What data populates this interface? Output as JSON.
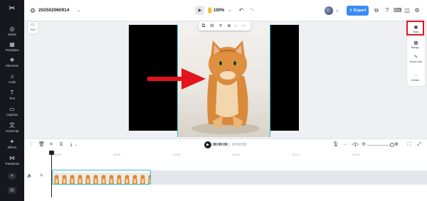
{
  "sidebar": {
    "items": [
      {
        "label": "Media",
        "icon": "media-icon"
      },
      {
        "label": "Templates",
        "icon": "templates-icon"
      },
      {
        "label": "Elements",
        "icon": "elements-icon"
      },
      {
        "label": "Audio",
        "icon": "audio-icon"
      },
      {
        "label": "Text",
        "icon": "text-icon"
      },
      {
        "label": "Captions",
        "icon": "captions-icon"
      },
      {
        "label": "Transcript",
        "icon": "transcript-icon"
      },
      {
        "label": "Effects",
        "icon": "effects-icon"
      },
      {
        "label": "Transitions",
        "icon": "transitions-icon"
      }
    ]
  },
  "topbar": {
    "project_name": "202502060914",
    "zoom": "100%",
    "export_label": "Export"
  },
  "canvas": {
    "ratio_label": "16:9"
  },
  "right_panel": {
    "items": [
      {
        "label": "Basic",
        "icon": "basic-icon"
      },
      {
        "label": "Backgr...",
        "icon": "background-icon"
      },
      {
        "label": "Smart tools",
        "icon": "smart-tools-icon"
      },
      {
        "label": "Animat...",
        "icon": "animation-icon"
      }
    ]
  },
  "playback": {
    "current_time": "00:00:00",
    "separator": "|",
    "total_time": "00:00:00"
  },
  "timeline": {
    "ruler": [
      "00:00",
      "00:03",
      "00:06",
      "00:09",
      "00:12",
      "00:15"
    ]
  },
  "colors": {
    "accent": "#3a8bf5",
    "selection": "#28c1d4",
    "highlight": "#e3141b",
    "sidebar_bg": "#16181d"
  }
}
